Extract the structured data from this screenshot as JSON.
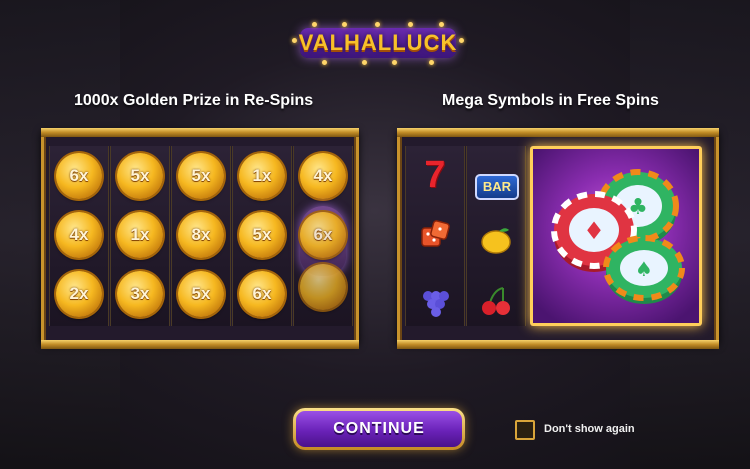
{
  "logo": {
    "text": "VALHALLUCK"
  },
  "headlines": {
    "left": "1000x Golden Prize in Re-Spins",
    "right": "Mega Symbols in Free Spins"
  },
  "left_panel": {
    "columns": [
      [
        "6x",
        "4x",
        "2x"
      ],
      [
        "5x",
        "1x",
        "3x"
      ],
      [
        "5x",
        "8x",
        "5x"
      ],
      [
        "1x",
        "5x",
        "6x"
      ],
      [
        "4x",
        "6x",
        ""
      ]
    ]
  },
  "right_panel": {
    "reel1": [
      "7",
      "dice-icon",
      "grapes-icon"
    ],
    "reel2": [
      "BAR",
      "lemon-icon",
      "cherries-icon"
    ],
    "mega_symbol": "casino-chips-icon"
  },
  "footer": {
    "continue_label": "CONTINUE",
    "dont_show_label": "Don't show again",
    "dont_show_checked": false
  },
  "colors": {
    "accent_gold": "#f6b820",
    "button_purple": "#6a22b8",
    "frame_gold": "#c8932c"
  }
}
